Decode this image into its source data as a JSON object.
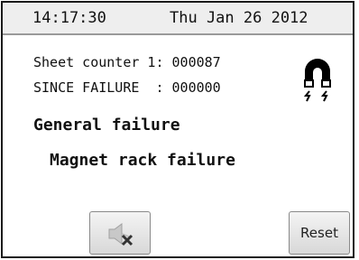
{
  "header": {
    "time": "14:17:30",
    "date": "Thu Jan 26 2012"
  },
  "counters": {
    "line1": "Sheet counter 1: 000087",
    "line2": "SINCE FAILURE  : 000000"
  },
  "messages": {
    "primary": "General failure",
    "secondary": "Magnet rack failure"
  },
  "icons": {
    "status_icon": "magnet-icon",
    "mute_icon": "speaker-muted-icon"
  },
  "buttons": {
    "reset_label": "Reset"
  }
}
